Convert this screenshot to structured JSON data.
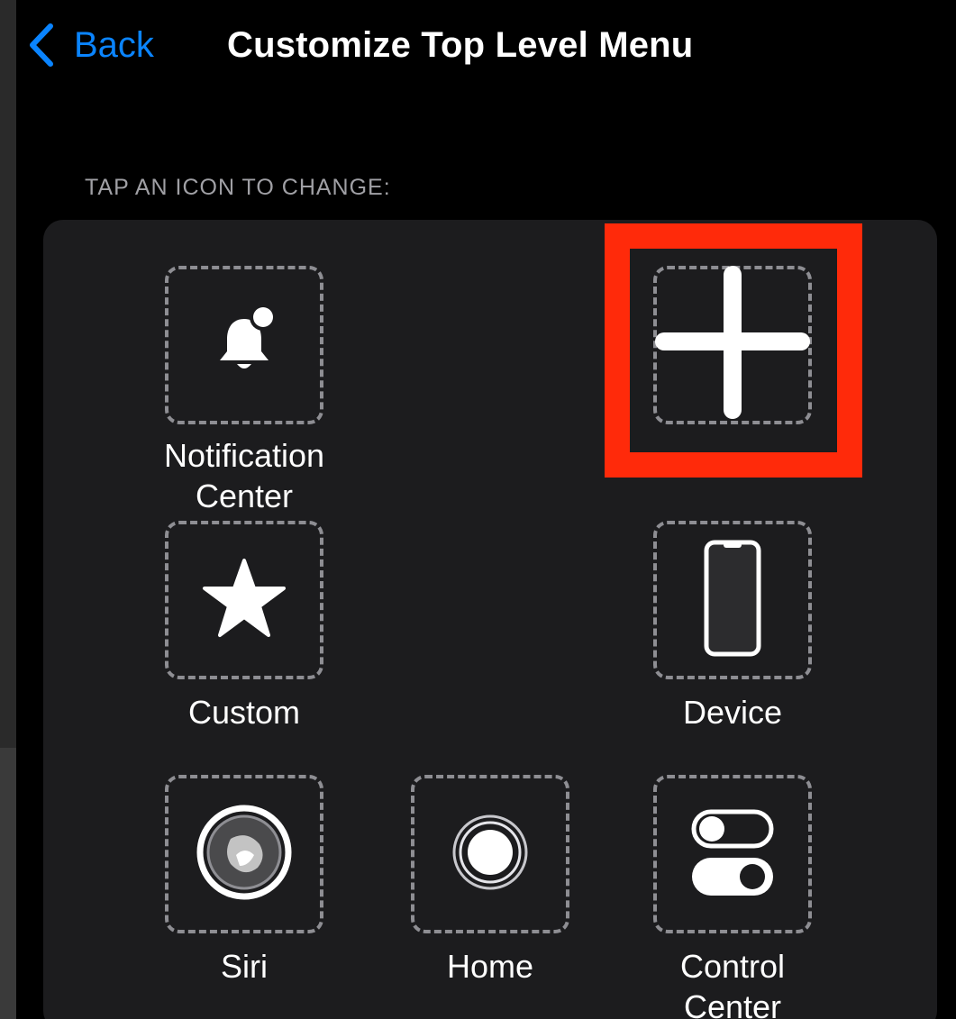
{
  "nav": {
    "back_label": "Back",
    "title": "Customize Top Level Menu"
  },
  "section_header": "TAP AN ICON TO CHANGE:",
  "slots": [
    {
      "label_line1": "Notification",
      "label_line2": "Center",
      "icon": "bell-badge-icon"
    },
    {
      "label_line1": "",
      "label_line2": "",
      "icon": "plus-icon",
      "highlighted": true
    },
    {
      "label_line1": "Custom",
      "label_line2": "",
      "icon": "star-icon"
    },
    {
      "label_line1": "Device",
      "label_line2": "",
      "icon": "iphone-device-icon"
    },
    {
      "label_line1": "Siri",
      "label_line2": "",
      "icon": "siri-icon"
    },
    {
      "label_line1": "Home",
      "label_line2": "",
      "icon": "home-button-icon"
    },
    {
      "label_line1": "Control",
      "label_line2": "Center",
      "icon": "control-toggles-icon"
    }
  ],
  "colors": {
    "accent": "#0a84ff",
    "highlight": "#ff2a0a",
    "panel": "#1c1c1e",
    "background": "#000000",
    "slot_border": "#8e8e93"
  }
}
